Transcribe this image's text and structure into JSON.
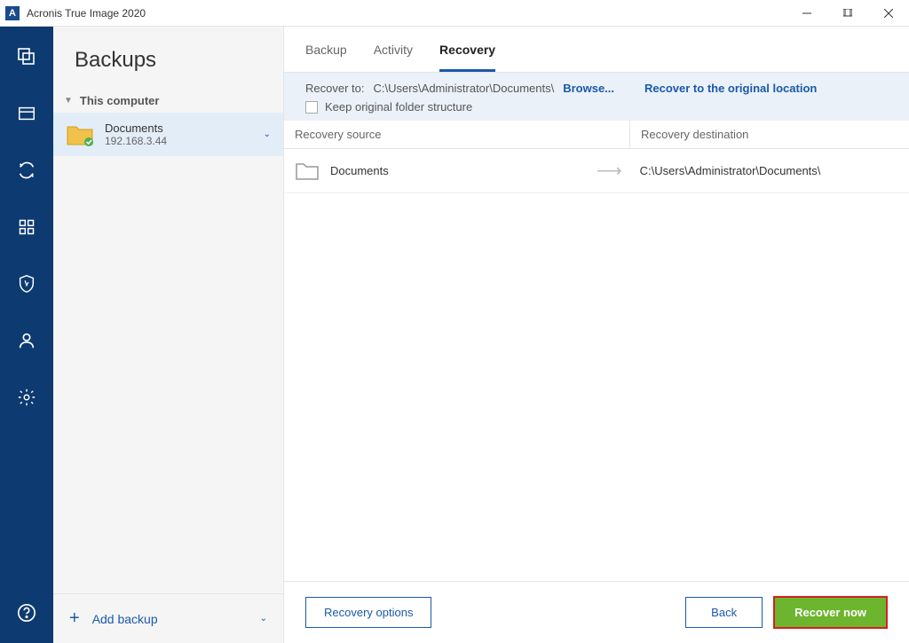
{
  "titlebar": {
    "title": "Acronis True Image 2020",
    "app_letter": "A"
  },
  "sidebar": {
    "heading": "Backups",
    "group": "This computer",
    "items": [
      {
        "name": "Documents",
        "sub": "192.168.3.44"
      }
    ],
    "add_backup": "Add backup"
  },
  "tabs": {
    "backup": "Backup",
    "activity": "Activity",
    "recovery": "Recovery"
  },
  "recover": {
    "label": "Recover to:",
    "path": "C:\\Users\\Administrator\\Documents\\",
    "browse": "Browse...",
    "original": "Recover to the original location",
    "keep_structure": "Keep original folder structure"
  },
  "columns": {
    "source": "Recovery source",
    "destination": "Recovery destination"
  },
  "rows": [
    {
      "source": "Documents",
      "destination": "C:\\Users\\Administrator\\Documents\\"
    }
  ],
  "footer": {
    "options": "Recovery options",
    "back": "Back",
    "recover_now": "Recover now"
  }
}
